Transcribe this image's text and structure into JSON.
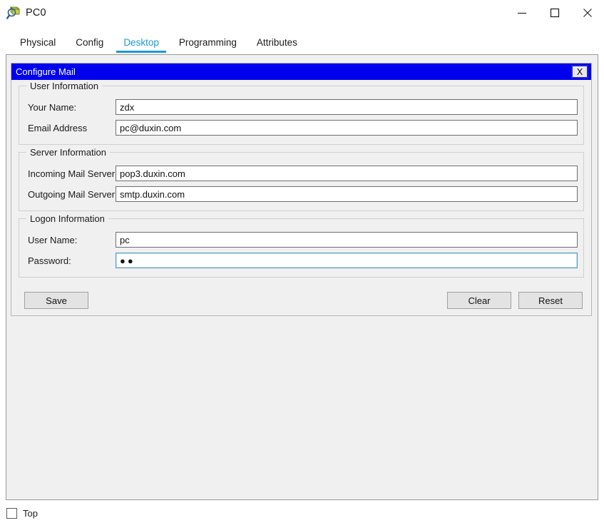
{
  "window": {
    "title": "PC0",
    "icon": "packet-tracer-pc-icon",
    "controls": {
      "minimize": "minimize-icon",
      "maximize": "maximize-icon",
      "close": "close-icon"
    }
  },
  "tabs": [
    {
      "label": "Physical",
      "active": false
    },
    {
      "label": "Config",
      "active": false
    },
    {
      "label": "Desktop",
      "active": true
    },
    {
      "label": "Programming",
      "active": false
    },
    {
      "label": "Attributes",
      "active": false
    }
  ],
  "dialog": {
    "title": "Configure Mail",
    "close_label": "X",
    "groups": {
      "user": {
        "title": "User Information",
        "fields": [
          {
            "label": "Your Name:",
            "value": "zdx"
          },
          {
            "label": "Email Address",
            "value": "pc@duxin.com"
          }
        ]
      },
      "server": {
        "title": "Server Information",
        "fields": [
          {
            "label": "Incoming Mail Server",
            "value": "pop3.duxin.com"
          },
          {
            "label": "Outgoing Mail Server",
            "value": "smtp.duxin.com"
          }
        ]
      },
      "logon": {
        "title": "Logon Information",
        "fields": [
          {
            "label": "User Name:",
            "value": "pc"
          },
          {
            "label": "Password:",
            "value": "●●"
          }
        ]
      }
    },
    "buttons": {
      "save": "Save",
      "clear": "Clear",
      "reset": "Reset"
    }
  },
  "bottom": {
    "top_checkbox_label": "Top",
    "top_checkbox_checked": false
  },
  "colors": {
    "accent_tab": "#1b9ad6",
    "dialog_titlebar": "#0000ee",
    "panel_bg": "#f0f0f0",
    "focus_border": "#4b9cbd"
  }
}
